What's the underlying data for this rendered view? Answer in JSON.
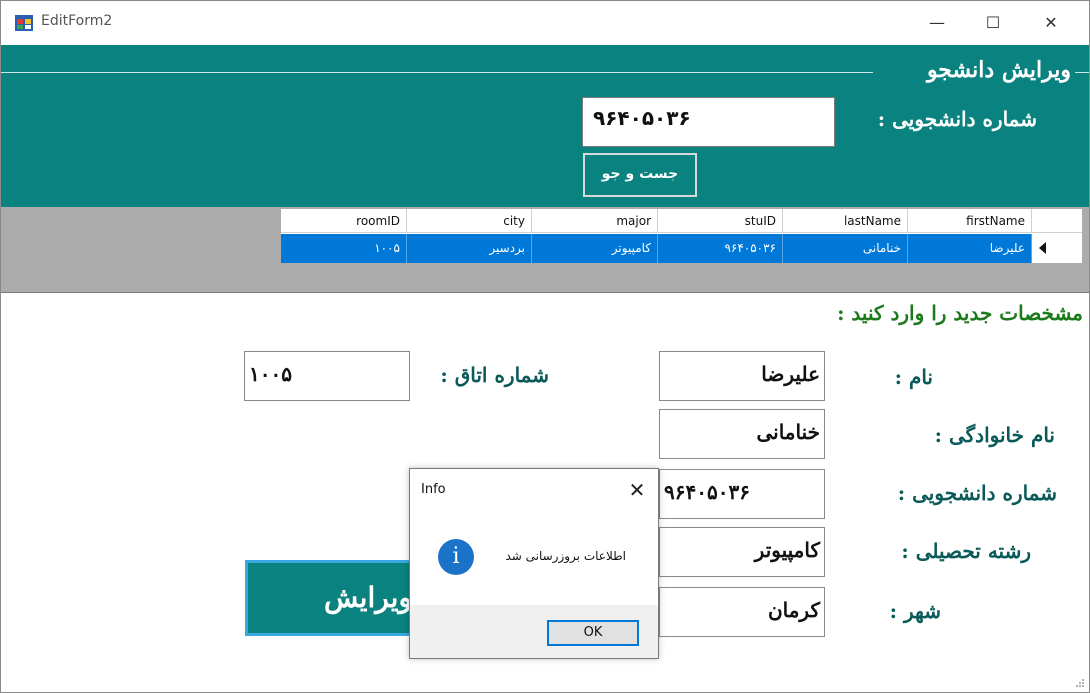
{
  "window": {
    "title": "EditForm2",
    "minimize_glyph": "—",
    "maximize_glyph": "☐",
    "close_glyph": "✕"
  },
  "search_group": {
    "title": "ویرایش دانشجو",
    "student_id_label": "شماره دانشجویی :",
    "student_id_value": "۹۶۴۰۵۰۳۶",
    "search_button": "جست و جو"
  },
  "grid": {
    "columns": [
      "roomID",
      "city",
      "major",
      "stuID",
      "lastName",
      "firstName"
    ],
    "rows": [
      [
        "۱۰۰۵",
        "بردسیر",
        "کامپیوتر",
        "۹۶۴۰۵۰۳۶",
        "خنامانی",
        "علیرضا"
      ]
    ]
  },
  "form": {
    "hint": "مشخصات جدید را وارد کنید :",
    "first_name_label": "نام :",
    "first_name_value": "علیرضا",
    "last_name_label": "نام خانوادگی :",
    "last_name_value": "خنامانی",
    "student_id_label": "شماره دانشجویی :",
    "student_id_value": "۹۶۴۰۵۰۳۶",
    "major_label": "رشته تحصیلی :",
    "major_value": "کامپیوتر",
    "city_label": "شهر :",
    "city_value": "کرمان",
    "room_label": "شماره اتاق :",
    "room_value": "۱۰۰۵",
    "edit_button": "ویرایش"
  },
  "dialog": {
    "title": "Info",
    "close_glyph": "✕",
    "icon_glyph": "i",
    "message": "اطلاعات بروزرسانی شد",
    "ok_button": "OK"
  },
  "colors": {
    "teal": "#0a827f",
    "selection_blue": "#0078d7",
    "label_dark_teal": "#0a5a59",
    "hint_green": "#1b7a1b"
  }
}
